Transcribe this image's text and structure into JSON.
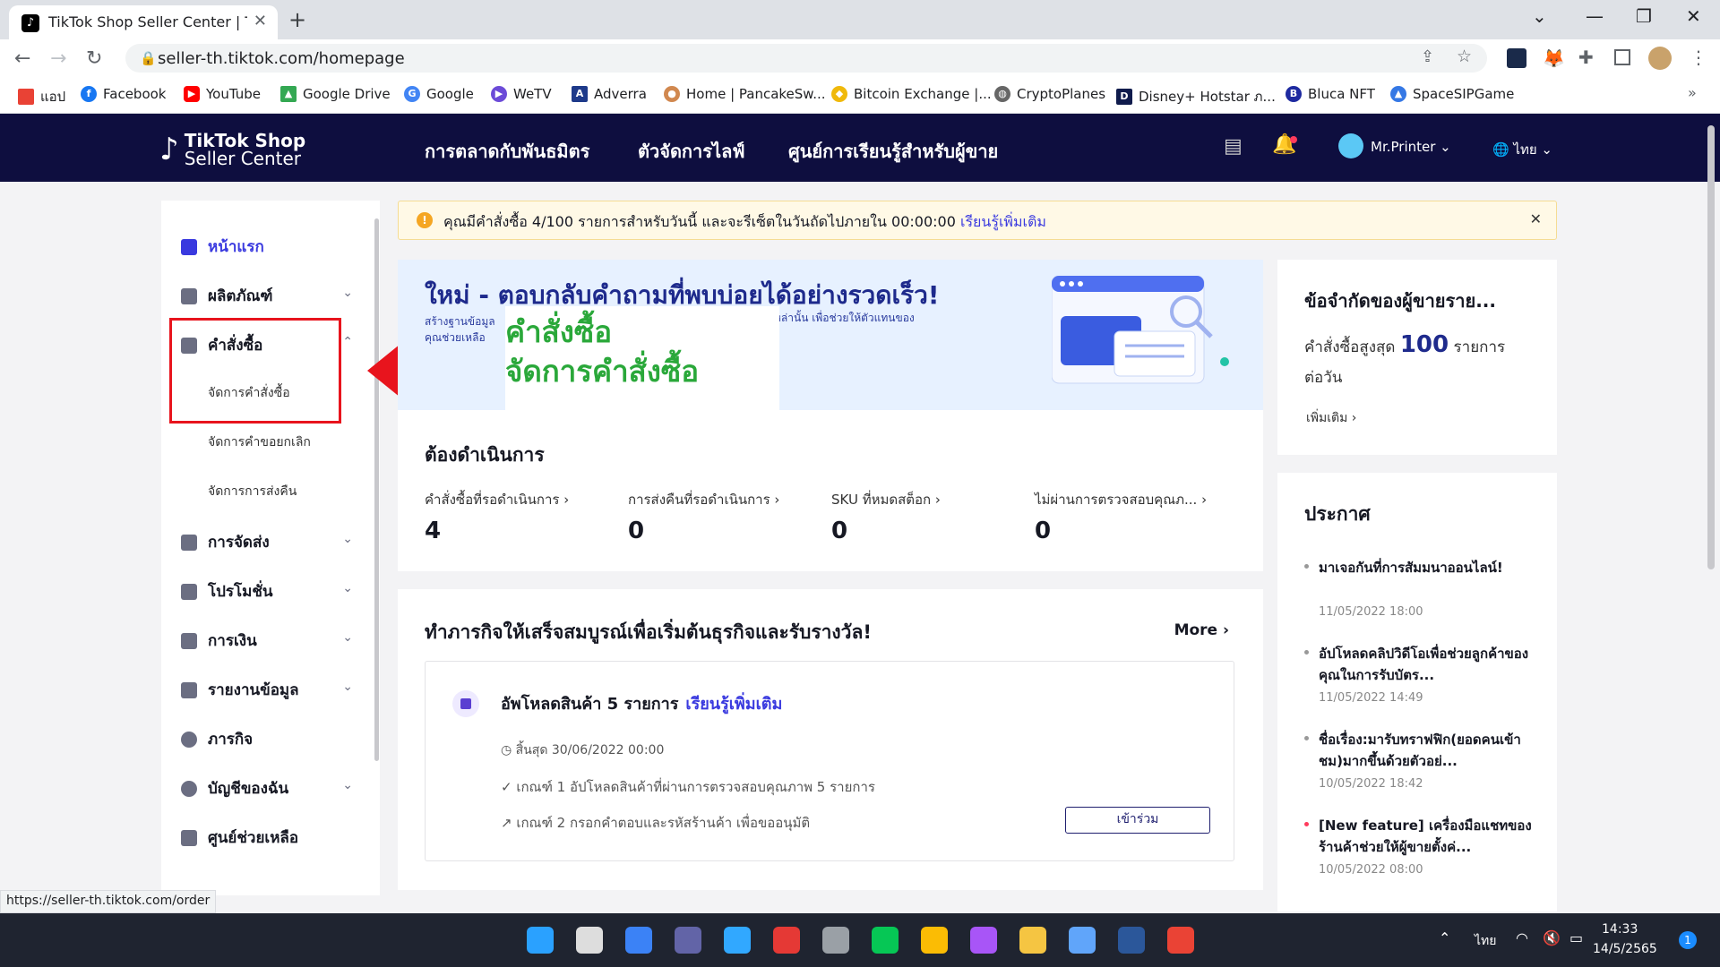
{
  "browser": {
    "tab_title": "TikTok Shop Seller Center | Thaila",
    "url": "seller-th.tiktok.com/homepage",
    "bookmarks": [
      "แอป",
      "Facebook",
      "YouTube",
      "Google Drive",
      "Google",
      "WeTV",
      "Adverra",
      "Home | PancakeSw...",
      "Bitcoin Exchange |...",
      "CryptoPlanes",
      "Disney+ Hotstar ภ...",
      "Bluca NFT",
      "SpaceSIPGame"
    ],
    "bookmark_colors": [
      "#e94235",
      "#1877f2",
      "#ff0000",
      "#34a853",
      "#4285f4",
      "#6c4bd8",
      "#1e3a8a",
      "#d1884f",
      "#f0b90b",
      "#666666",
      "#0f1b4c",
      "#1e2aa0",
      "#3578e5"
    ],
    "status_url": "https://seller-th.tiktok.com/order"
  },
  "header": {
    "logo_line1": "TikTok Shop",
    "logo_line2": "Seller Center",
    "nav": [
      "การตลาดกับพันธมิตร",
      "ตัวจัดการไลฟ์",
      "ศูนย์การเรียนรู้สำหรับผู้ขาย"
    ],
    "user": "Mr.Printer ⌄",
    "lang": "🌐 ไทย ⌄"
  },
  "sidebar": {
    "items": [
      {
        "label": "หน้าแรก",
        "icon": "home-icon",
        "color": "#3a3adf"
      },
      {
        "label": "ผลิตภัณฑ์",
        "icon": "product-icon",
        "chevron": "⌄"
      },
      {
        "label": "คำสั่งซื้อ",
        "icon": "order-icon",
        "chevron": "⌃"
      },
      {
        "label": "การจัดส่ง",
        "icon": "shipping-icon",
        "chevron": "⌄"
      },
      {
        "label": "โปรโมชั่น",
        "icon": "promotion-icon",
        "chevron": "⌄"
      },
      {
        "label": "การเงิน",
        "icon": "finance-icon",
        "chevron": "⌄"
      },
      {
        "label": "รายงานข้อมูล",
        "icon": "report-icon",
        "chevron": "⌄"
      },
      {
        "label": "ภารกิจ",
        "icon": "mission-icon"
      },
      {
        "label": "บัญชีของฉัน",
        "icon": "account-icon",
        "chevron": "⌄"
      },
      {
        "label": "ศูนย์ช่วยเหลือ",
        "icon": "help-icon"
      }
    ],
    "sub_orders": [
      "จัดการคำสั่งซื้อ",
      "จัดการคำขอยกเลิก",
      "จัดการการส่งคืน"
    ]
  },
  "notice": {
    "text": "คุณมีคำสั่งซื้อ 4/100 รายการสำหรับวันนี้ และจะรีเซ็ตในวันถัดไปภายใน 00:00:00",
    "link": "เรียนรู้เพิ่มเติม"
  },
  "promo": {
    "headline": "ใหม่ - ตอบกลับคำถามที่พบบ่อยได้อย่างรวดเร็ว!",
    "sub1": "สร้างฐานข้อมูล",
    "sub2": "คุณช่วยเหลือ",
    "sub3": "หล่านั้น เพื่อช่วยให้ตัวแทนของ"
  },
  "overlay": {
    "line1": "คำสั่งซื้อ",
    "line2": "จัดการคำสั่งซื้อ"
  },
  "actions": {
    "title": "ต้องดำเนินการ",
    "metrics": [
      {
        "label": "คำสั่งซื้อที่รอดำเนินการ ›",
        "value": "4"
      },
      {
        "label": "การส่งคืนที่รอดำเนินการ ›",
        "value": "0"
      },
      {
        "label": "SKU ที่หมดสต็อก ›",
        "value": "0"
      },
      {
        "label": "ไม่ผ่านการตรวจสอบคุณภ... ›",
        "value": "0"
      }
    ]
  },
  "tasks": {
    "title": "ทำภารกิจให้เสร็จสมบูรณ์เพื่อเริ่มต้นธุรกิจและรับรางวัล!",
    "more": "More ›",
    "task_title": "อัพโหลดสินค้า 5 รายการ",
    "task_link": "เรียนรู้เพิ่มเติม",
    "deadline": "◷ สิ้นสุด 30/06/2022 00:00",
    "criteria1": "✓  เกณฑ์ 1   อัปโหลดสินค้าที่ผ่านการตรวจสอบคุณภาพ 5 รายการ",
    "criteria2": "↗  เกณฑ์ 2   กรอกคำตอบและรหัสร้านค้า เพื่อขออนุมัติ",
    "join": "เข้าร่วม"
  },
  "limit": {
    "title": "ข้อจำกัดของผู้ขายราย...",
    "prefix": "คำสั่งซื้อสูงสุด",
    "number": "100",
    "suffix": "รายการ",
    "line2": "ต่อวัน",
    "more": "เพิ่มเติม ›"
  },
  "news": {
    "title": "ประกาศ",
    "items": [
      {
        "title": "มาเจอกันที่การสัมมนาออนไลน์!",
        "date": "11/05/2022 18:00"
      },
      {
        "title": "อัปโหลดคลิปวิดีโอเพื่อช่วยลูกค้าของคุณในการรับบัตร...",
        "date": "11/05/2022 14:49"
      },
      {
        "title": "ชื่อเรื่อง:มารับทราฟฟิก(ยอดคนเข้าชม)มากขึ้นด้วยตัวอย่...",
        "date": "10/05/2022 18:42"
      },
      {
        "title": "[New feature] เครื่องมือแชทของร้านค้าช่วยให้ผู้ขายตั้งค่...",
        "date": "10/05/2022 08:00"
      }
    ]
  },
  "taskbar": {
    "lang": "ไทย",
    "time": "14:33",
    "date": "14/5/2565",
    "notifications": "1",
    "apps": [
      "start",
      "search",
      "widgets",
      "meet",
      "photoshop",
      "camera",
      "calculator",
      "line",
      "chrome",
      "messenger",
      "explorer",
      "notepad",
      "word",
      "chrome-profile"
    ],
    "app_colors": [
      "#2aa1ff",
      "#dddddd",
      "#3b82f6",
      "#6264a7",
      "#31a8ff",
      "#e53935",
      "#9aa0a6",
      "#06c755",
      "#fbbc04",
      "#a855f7",
      "#f5c542",
      "#60a5fa",
      "#2b579a",
      "#ea4335"
    ]
  }
}
